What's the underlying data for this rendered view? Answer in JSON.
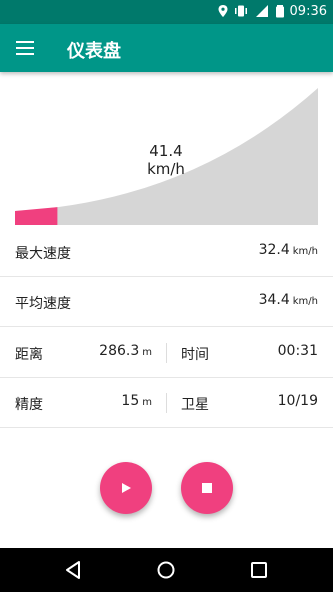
{
  "status_bar": {
    "time": "09:36",
    "icons": [
      "location-icon",
      "vibrate-icon",
      "signal-icon",
      "battery-icon"
    ]
  },
  "app_bar": {
    "title": "仪表盘",
    "menu_icon": "hamburger-icon"
  },
  "gauge": {
    "speed_value": "41.4",
    "speed_unit": "km/h",
    "progress_fraction": 0.14
  },
  "stats": {
    "max_speed": {
      "label": "最大速度",
      "value": "32.4",
      "unit": "km/h"
    },
    "avg_speed": {
      "label": "平均速度",
      "value": "34.4",
      "unit": "km/h"
    },
    "distance": {
      "label": "距离",
      "value": "286.3",
      "unit": "m"
    },
    "time": {
      "label": "时间",
      "value": "00:31"
    },
    "accuracy": {
      "label": "精度",
      "value": "15",
      "unit": "m"
    },
    "satellites": {
      "label": "卫星",
      "value": "10/19"
    }
  },
  "controls": {
    "play_icon": "play-icon",
    "stop_icon": "stop-icon"
  },
  "nav_bar": {
    "icons": [
      "back-icon",
      "home-icon",
      "recents-icon"
    ]
  },
  "colors": {
    "primary": "#009688",
    "primary_dark": "#00796b",
    "accent": "#f0407f",
    "gauge_bg": "#d6d6d6"
  }
}
